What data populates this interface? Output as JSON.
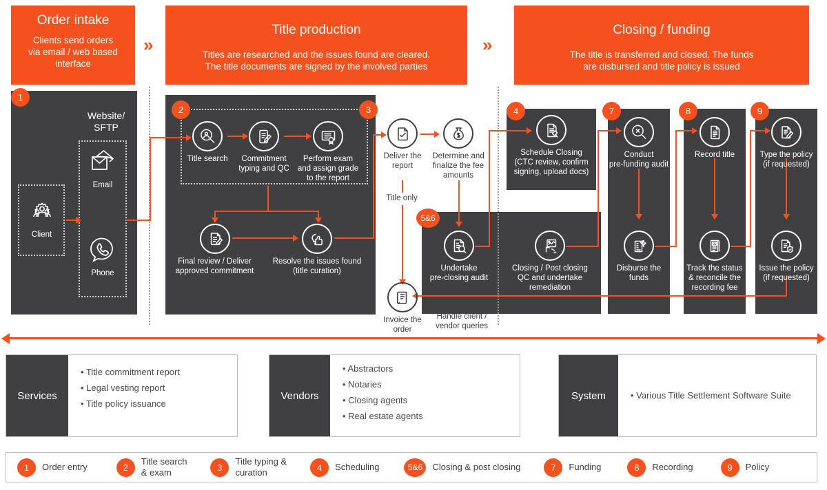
{
  "colors": {
    "accent": "#f4511e",
    "panel_dark": "#404042",
    "text_dark": "#3d3d3d"
  },
  "phases": [
    {
      "title": "Order intake",
      "desc": "Clients send orders\nvia email / web based\ninterface"
    },
    {
      "title": "Title production",
      "desc": "Titles are researched and the issues found are cleared.\nThe title documents are signed by the involved parties"
    },
    {
      "title": "Closing / funding",
      "desc": "The title is transferred and closed. The funds\nare disbursed and title policy is issued"
    }
  ],
  "chevrons": [
    "»",
    "»"
  ],
  "badges": {
    "b1": "1",
    "b2": "2",
    "b3": "3",
    "b4": "4",
    "b56": "5&6",
    "b7": "7",
    "b8": "8",
    "b9": "9"
  },
  "intake": {
    "channel_title": "Website/\nSFTP",
    "client_label": "Client",
    "email_label": "Email",
    "phone_label": "Phone"
  },
  "nodes": {
    "title_search": "Title search",
    "commitment_typing": "Commitment\ntyping and QC",
    "perform_exam": "Perform exam\nand assign grade\nto the report",
    "final_review": "Final review / Deliver\napproved commitment",
    "resolve_issues": "Resolve the issues found\n(title curation)",
    "deliver_report": "Deliver the\nreport",
    "determine_fee": "Determine and\nfinalize the fee\namounts",
    "invoice_order": "Invoice the\norder",
    "pre_closing_audit": "Undertake\npre-closing audit",
    "handle_queries": "Handle client /\nvendor queries",
    "schedule_closing": "Schedule Closing\n(CTC review, confirm\nsigning, upload docs)",
    "closing_qc": "Closing / Post closing\nQC and undertake\nremediation",
    "pre_funding_audit": "Conduct\npre-funding audit",
    "disburse_funds": "Disburse the\nfunds",
    "record_title": "Record title",
    "track_status": "Track the status\n& reconcile the\nrecording fee",
    "type_policy": "Type the policy\n(if requested)",
    "issue_policy": "Issue the policy\n(if requested)"
  },
  "edge_labels": {
    "title_only": "Title only"
  },
  "info_boxes": [
    {
      "label": "Services",
      "items": [
        "• Title commitment report",
        "• Legal vesting report",
        "• Title policy issuance"
      ]
    },
    {
      "label": "Vendors",
      "items": [
        "• Abstractors",
        "• Notaries",
        "• Closing agents",
        "• Real estate agents"
      ]
    },
    {
      "label": "System",
      "items": [
        "• Various Title Settlement Software Suite"
      ]
    }
  ],
  "legend": [
    {
      "num": "1",
      "text": "Order entry"
    },
    {
      "num": "2",
      "text": "Title search\n& exam"
    },
    {
      "num": "3",
      "text": "Title typing &\ncuration"
    },
    {
      "num": "4",
      "text": "Scheduling"
    },
    {
      "num": "5&6",
      "text": "Closing & post closing"
    },
    {
      "num": "7",
      "text": "Funding"
    },
    {
      "num": "8",
      "text": "Recording"
    },
    {
      "num": "9",
      "text": "Policy"
    }
  ]
}
